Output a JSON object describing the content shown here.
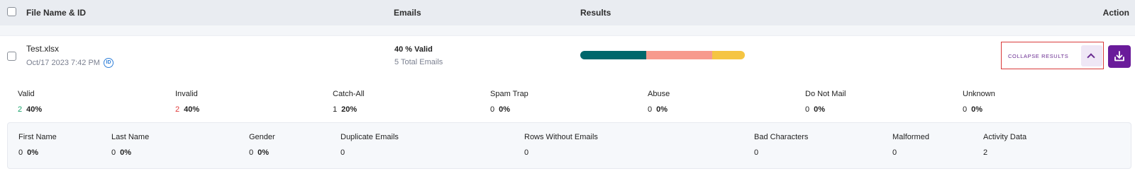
{
  "header": {
    "file_col": "File Name & ID",
    "emails_col": "Emails",
    "results_col": "Results",
    "action_col": "Action"
  },
  "row": {
    "file_name": "Test.xlsx",
    "date": "Oct/17 2023 7:42 PM",
    "id_icon": "ID",
    "valid_text": "40 % Valid",
    "total_text": "5 Total Emails",
    "collapse_label": "COLLAPSE RESULTS",
    "chevron_icon": "chevron-up-icon",
    "download_icon": "download-icon",
    "result_bar": [
      {
        "name": "valid",
        "fraction": 0.4,
        "color": "#00676b"
      },
      {
        "name": "invalid",
        "fraction": 0.4,
        "color": "#f79a8d"
      },
      {
        "name": "catch-all",
        "fraction": 0.2,
        "color": "#f5c542"
      }
    ]
  },
  "stats": [
    {
      "label": "Valid",
      "count": "2",
      "pct": "40%",
      "count_color": "#1aa36b"
    },
    {
      "label": "Invalid",
      "count": "2",
      "pct": "40%",
      "count_color": "#e03b3b"
    },
    {
      "label": "Catch-All",
      "count": "1",
      "pct": "20%",
      "count_color": "#222222"
    },
    {
      "label": "Spam Trap",
      "count": "0",
      "pct": "0%",
      "count_color": "#222222"
    },
    {
      "label": "Abuse",
      "count": "0",
      "pct": "0%",
      "count_color": "#222222"
    },
    {
      "label": "Do Not Mail",
      "count": "0",
      "pct": "0%",
      "count_color": "#222222"
    },
    {
      "label": "Unknown",
      "count": "0",
      "pct": "0%",
      "count_color": "#222222"
    }
  ],
  "details": [
    {
      "label": "First Name",
      "count": "0",
      "pct": "0%"
    },
    {
      "label": "Last Name",
      "count": "0",
      "pct": "0%"
    },
    {
      "label": "Gender",
      "count": "0",
      "pct": "0%"
    },
    {
      "label": "Duplicate Emails",
      "count": "0",
      "pct": ""
    },
    {
      "label": "Rows Without Emails",
      "count": "0",
      "pct": ""
    },
    {
      "label": "Bad Characters",
      "count": "0",
      "pct": ""
    },
    {
      "label": "Malformed",
      "count": "0",
      "pct": ""
    },
    {
      "label": "Activity Data",
      "count": "2",
      "pct": ""
    }
  ]
}
